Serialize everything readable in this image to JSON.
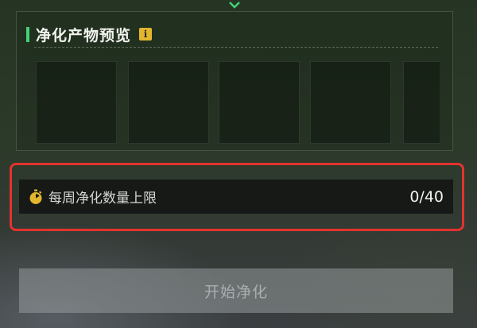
{
  "preview": {
    "title": "净化产物预览",
    "info_icon": "i"
  },
  "weekly_limit": {
    "label": "每周净化数量上限",
    "value": "0/40",
    "icon": "stopwatch-icon"
  },
  "actions": {
    "start_label": "开始净化"
  },
  "colors": {
    "accent": "#43d17a",
    "info": "#e3b62e",
    "highlight": "#e2332e"
  }
}
